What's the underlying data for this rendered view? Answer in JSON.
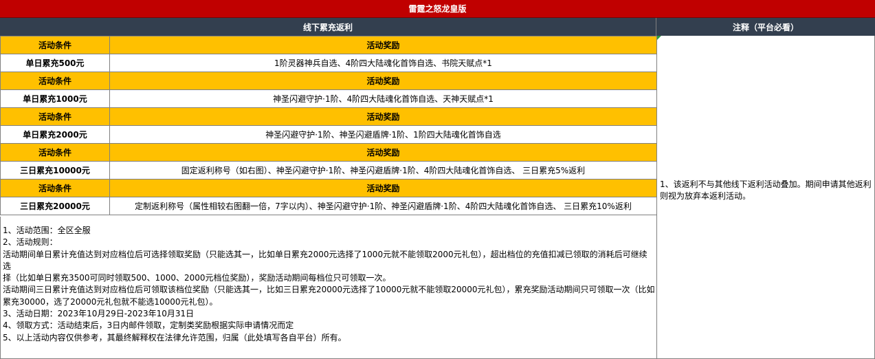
{
  "title": "雷霆之怒龙皇版",
  "left_header": "线下累充返利",
  "right_header": "注释（平台必看）",
  "condition_header": "活动条件",
  "reward_header": "活动奖励",
  "tiers": [
    {
      "condition": "单日累充500元",
      "reward": "1阶灵器神兵自选、4阶四大陆魂化首饰自选、书院天赋点*1"
    },
    {
      "condition": "单日累充1000元",
      "reward": "神圣闪避守护·1阶、4阶四大陆魂化首饰自选、天神天赋点*1"
    },
    {
      "condition": "单日累充2000元",
      "reward": "神圣闪避守护·1阶、神圣闪避盾牌·1阶、1阶四大陆魂化首饰自选"
    },
    {
      "condition": "三日累充10000元",
      "reward": "固定返利称号（如右图）、神圣闪避守护·1阶、神圣闪避盾牌·1阶、4阶四大陆魂化首饰自选、 三日累充5%返利"
    },
    {
      "condition": "三日累充20000元",
      "reward": "定制返利称号（属性相较右图翻一倍，7字以内）、神圣闪避守护·1阶、神圣闪避盾牌·1阶、4阶四大陆魂化首饰自选、 三日累充10%返利"
    }
  ],
  "rules": [
    "1、活动范围：全区全服",
    "2、活动规则：",
    "活动期间单日累计充值达到对应档位后可选择领取奖励（只能选其一，比如单日累充2000元选择了1000元就不能领取2000元礼包），超出档位的充值扣减已领取的消耗后可继续选",
    "择（比如单日累充3500可同时领取500、1000、2000元档位奖励），奖励活动期间每档位只可领取一次。",
    "活动期间三日累计充值达到对应档位后可领取该档位奖励（只能选其一，比如三日累充20000元选择了10000元就不能领取20000元礼包），累充奖励活动期间只可领取一次（比如",
    "累充30000，选了20000元礼包就不能选10000元礼包）。",
    "3、活动日期：2023年10月29日-2023年10月31日",
    "4、领取方式：活动结束后，3日内邮件领取，定制类奖励根据实际申请情况而定",
    "5、以上活动内容仅供参考，其最终解释权在法律允许范围，归属（此处填写各自平台）所有。"
  ],
  "notes": [
    "1、该返利不与其他线下返利活动叠加。期间申请其他返利",
    "则视为放弃本返利活动。"
  ]
}
